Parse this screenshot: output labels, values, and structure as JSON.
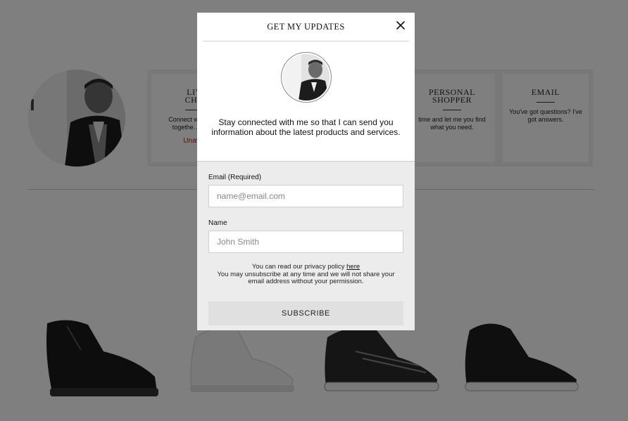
{
  "background": {
    "cards": [
      {
        "title_line1": "LIV",
        "title_line2": "CHA",
        "body": "Connect w… shop togethe… tim…",
        "status": "Unavai"
      },
      {
        "title_line1": "PERSONAL",
        "title_line2": "SHOPPER",
        "body": "time and let me you find what you need."
      },
      {
        "title_line1": "EMAIL",
        "title_line2": "",
        "body": "You've got questions? I've got answers."
      }
    ]
  },
  "modal": {
    "title": "GET MY UPDATES",
    "intro": "Stay connected with me so that I can send you information about the latest products and services.",
    "email_label": "Email (Required)",
    "email_placeholder": "name@email.com",
    "name_label": "Name",
    "name_placeholder": "John Smith",
    "privacy_prefix": "You can read our privacy policy",
    "privacy_link": "here",
    "privacy_note": "You may unsubscribe at any time and we will not share your email address without your permission.",
    "subscribe_label": "SUBSCRIBE"
  }
}
